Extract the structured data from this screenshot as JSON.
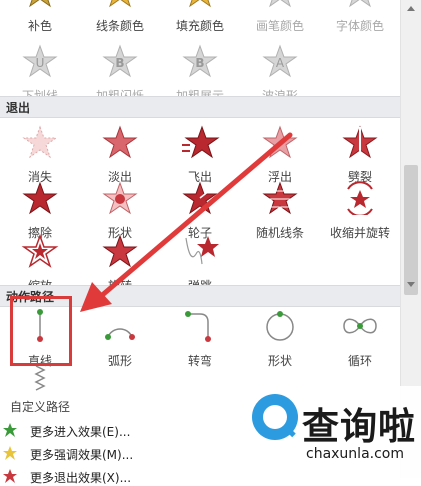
{
  "row0": [
    "补色",
    "线条颜色",
    "填充颜色",
    "画笔颜色",
    "字体颜色"
  ],
  "row1": [
    "下划线",
    "加粗闪烁",
    "加粗展示",
    "波浪形"
  ],
  "exit": {
    "title": "退出",
    "row0": [
      "消失",
      "淡出",
      "飞出",
      "浮出",
      "劈裂"
    ],
    "row1": [
      "擦除",
      "形状",
      "轮子",
      "随机线条",
      "收缩并旋转"
    ],
    "row2": [
      "缩放",
      "旋转",
      "弹跳"
    ]
  },
  "motion": {
    "title": "动作路径",
    "items": [
      "直线",
      "弧形",
      "转弯",
      "形状",
      "循环"
    ],
    "custom": "自定义路径"
  },
  "menu": [
    "更多进入效果(E)...",
    "更多强调效果(M)...",
    "更多退出效果(X)..."
  ],
  "logo": {
    "text": "查询啦",
    "sub": "chaxunla.com"
  },
  "colors": {
    "accent": "#d93a3a",
    "star_red": "#b8282e",
    "star_gold": "#e8b43a",
    "logo_blue": "#2c9be0",
    "section_bg": "#e9ebee"
  }
}
